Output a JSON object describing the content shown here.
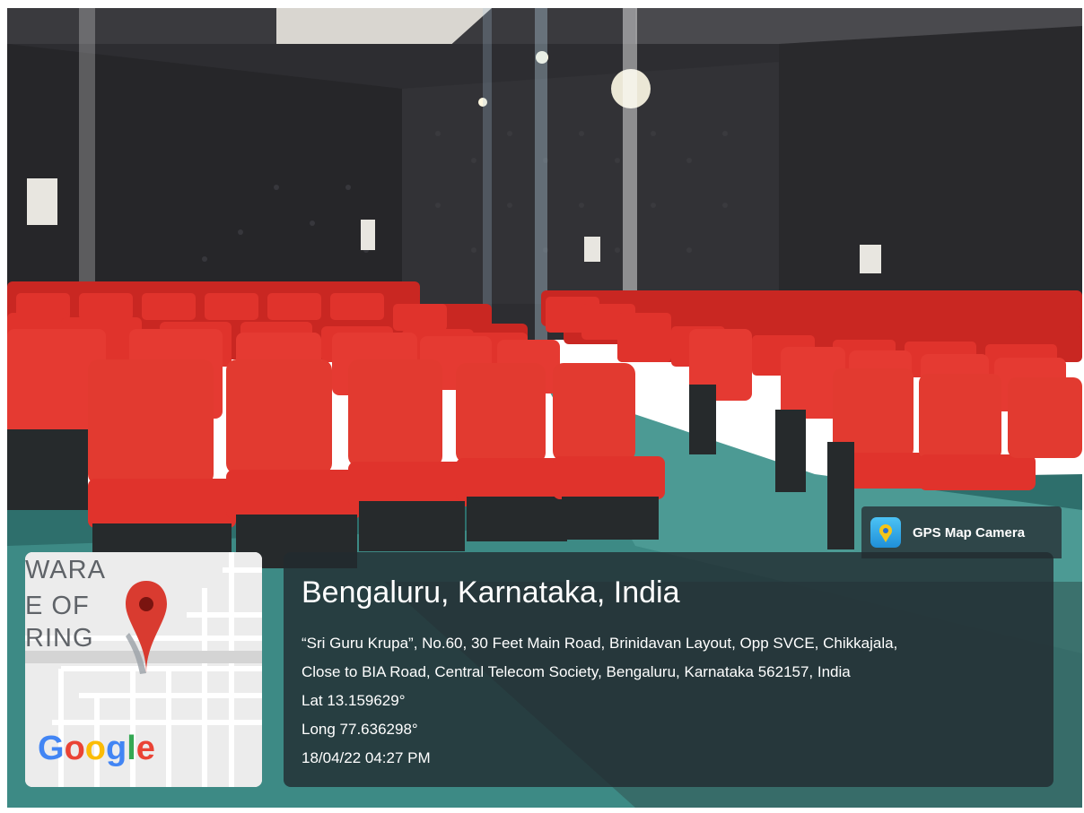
{
  "badge": {
    "app_name": "GPS Map Camera",
    "icon": "gps-camera-icon"
  },
  "map": {
    "label_lines": [
      "WARA",
      "E OF",
      "RING"
    ],
    "logo": "Google",
    "pin_icon": "map-pin-icon"
  },
  "info": {
    "title": "Bengaluru, Karnataka, India",
    "address_line1": "“Sri Guru Krupa”, No.60, 30 Feet Main Road, Brinidavan Layout, Opp SVCE, Chikkajala,",
    "address_line2": "Close to BIA Road, Central Telecom Society, Bengaluru, Karnataka 562157, India",
    "lat": "Lat 13.159629°",
    "long": "Long 77.636298°",
    "datetime": "18/04/22 04:27 PM"
  },
  "colors": {
    "seat_red": "#e0302a",
    "wall": "#2b2b2e",
    "floor": "#3d8a85",
    "overlay": "#222a30",
    "pin_red": "#d93b30"
  }
}
